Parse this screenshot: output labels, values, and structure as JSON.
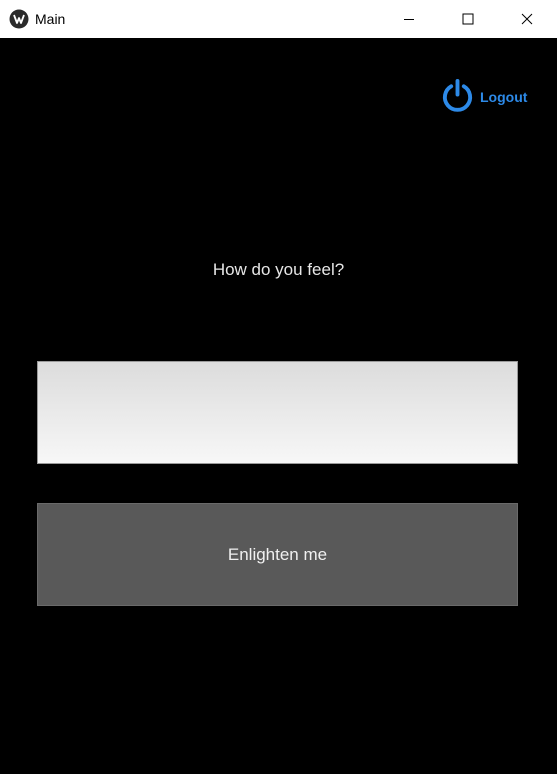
{
  "window": {
    "title": "Main",
    "controls": {
      "minimize": "minimize-icon",
      "maximize": "maximize-icon",
      "close": "close-icon"
    }
  },
  "header": {
    "logout_label": "Logout",
    "logout_icon": "power-icon",
    "accent_color": "#2d8ae8"
  },
  "main": {
    "prompt": "How do you feel?",
    "feeling_input": {
      "value": "",
      "placeholder": ""
    },
    "submit_label": "Enlighten me"
  }
}
